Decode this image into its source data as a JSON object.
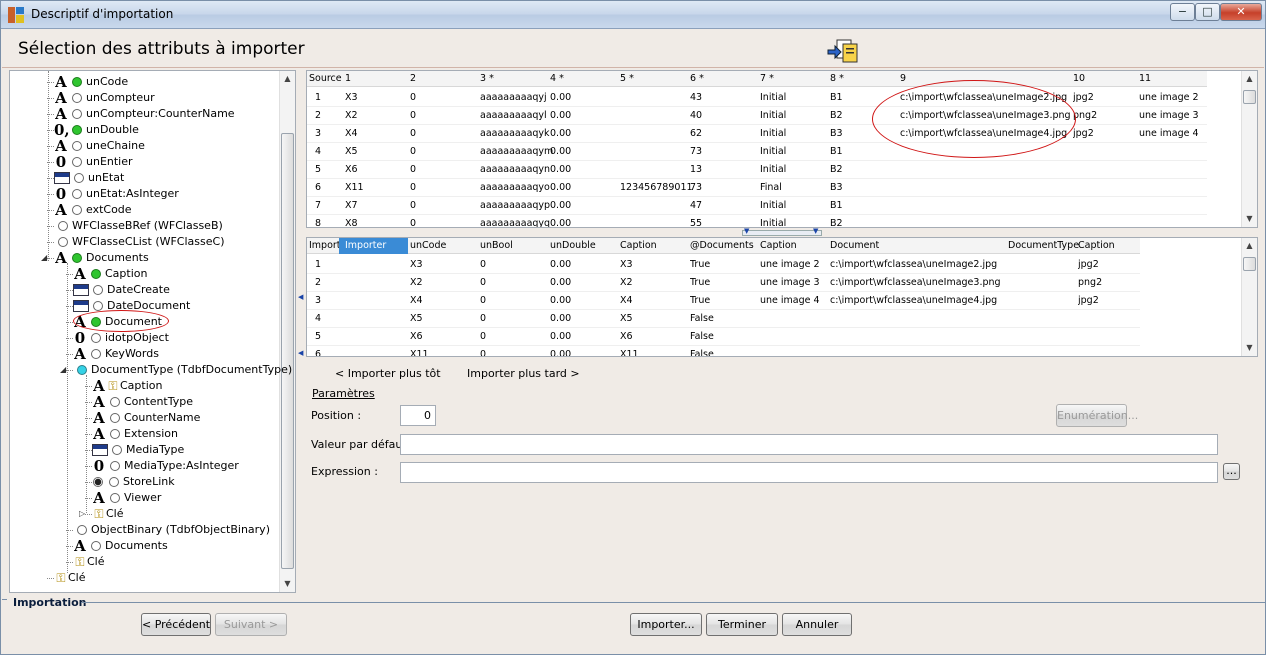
{
  "window": {
    "title": "Descriptif d'importation",
    "minimize": "−",
    "maximize": "□",
    "close": "✕"
  },
  "page_title": "Sélection des attributs à importer",
  "tree": {
    "items": [
      {
        "icon": "A",
        "dot": "green",
        "label": "unCode"
      },
      {
        "icon": "A",
        "dot": "empty",
        "label": "unCompteur"
      },
      {
        "icon": "A",
        "dot": "empty",
        "label": "unCompteur:CounterName"
      },
      {
        "icon": "0,",
        "dot": "green",
        "label": "unDouble"
      },
      {
        "icon": "A",
        "dot": "empty",
        "label": "uneChaine"
      },
      {
        "icon": "0",
        "dot": "empty",
        "label": "unEntier"
      },
      {
        "icon": "enum",
        "dot": "empty",
        "label": "unEtat"
      },
      {
        "icon": "0",
        "dot": "empty",
        "label": "unEtat:AsInteger"
      },
      {
        "icon": "A",
        "dot": "empty",
        "label": "extCode"
      },
      {
        "icon": "",
        "dot": "empty",
        "label": "WFClasseBRef (WFClasseB)"
      },
      {
        "icon": "",
        "dot": "empty",
        "label": "WFClasseCList (WFClasseC)"
      },
      {
        "icon": "A",
        "dot": "green",
        "label": "Documents"
      },
      {
        "icon": "A",
        "dot": "green",
        "label": "Caption"
      },
      {
        "icon": "date",
        "dot": "empty",
        "label": "DateCreate"
      },
      {
        "icon": "date",
        "dot": "empty",
        "label": "DateDocument"
      },
      {
        "icon": "A",
        "dot": "green",
        "label": "Document"
      },
      {
        "icon": "0",
        "dot": "empty",
        "label": "idotpObject"
      },
      {
        "icon": "A",
        "dot": "empty",
        "label": "KeyWords"
      },
      {
        "icon": "",
        "dot": "cyan",
        "label": "DocumentType (TdbfDocumentType)"
      },
      {
        "icon": "A",
        "dot": "key",
        "label": "Caption"
      },
      {
        "icon": "A",
        "dot": "empty",
        "label": "ContentType"
      },
      {
        "icon": "A",
        "dot": "empty",
        "label": "CounterName"
      },
      {
        "icon": "A",
        "dot": "empty",
        "label": "Extension"
      },
      {
        "icon": "enum",
        "dot": "empty",
        "label": "MediaType"
      },
      {
        "icon": "0",
        "dot": "empty",
        "label": "MediaType:AsInteger"
      },
      {
        "icon": "radio",
        "dot": "empty",
        "label": "StoreLink"
      },
      {
        "icon": "A",
        "dot": "empty",
        "label": "Viewer"
      },
      {
        "icon": "key",
        "dot": "none",
        "label": "Clé"
      },
      {
        "icon": "",
        "dot": "empty",
        "label": "ObjectBinary (TdbfObjectBinary)"
      },
      {
        "icon": "A",
        "dot": "empty",
        "label": "Documents"
      },
      {
        "icon": "key",
        "dot": "none",
        "label": "Clé"
      },
      {
        "icon": "key",
        "dot": "none",
        "label": "Clé"
      }
    ]
  },
  "source_grid": {
    "headers": [
      "Source",
      "1",
      "2",
      "3 *",
      "4 *",
      "5 *",
      "6 *",
      "7 *",
      "8 *",
      "9",
      "10",
      "11"
    ],
    "rows": [
      [
        "1",
        "X3",
        "0",
        "aaaaaaaaaqyj",
        "0.00",
        "",
        "43",
        "Initial",
        "B1",
        "c:\\import\\wfclassea\\uneImage2.jpg",
        "jpg2",
        "une image 2"
      ],
      [
        "2",
        "X2",
        "0",
        "aaaaaaaaaqyl",
        "0.00",
        "",
        "40",
        "Initial",
        "B2",
        "c:\\import\\wfclassea\\uneImage3.png",
        "png2",
        "une image 3"
      ],
      [
        "3",
        "X4",
        "0",
        "aaaaaaaaaqyk",
        "0.00",
        "",
        "62",
        "Initial",
        "B3",
        "c:\\import\\wfclassea\\uneImage4.jpg",
        "jpg2",
        "une image 4"
      ],
      [
        "4",
        "X5",
        "0",
        "aaaaaaaaaqym",
        "0.00",
        "",
        "73",
        "Initial",
        "B1",
        "",
        "",
        ""
      ],
      [
        "5",
        "X6",
        "0",
        "aaaaaaaaaqyn",
        "0.00",
        "",
        "13",
        "Initial",
        "B2",
        "",
        "",
        ""
      ],
      [
        "6",
        "X11",
        "0",
        "aaaaaaaaaqyo",
        "0.00",
        "123456789011",
        "73",
        "Final",
        "B3",
        "",
        "",
        ""
      ],
      [
        "7",
        "X7",
        "0",
        "aaaaaaaaaqyp",
        "0.00",
        "",
        "47",
        "Initial",
        "B1",
        "",
        "",
        ""
      ],
      [
        "8",
        "X8",
        "0",
        "aaaaaaaaaqyq",
        "0.00",
        "",
        "55",
        "Initial",
        "B2",
        "",
        "",
        ""
      ]
    ]
  },
  "import_grid": {
    "headers": [
      "Import",
      "Importer",
      "unCode",
      "unBool",
      "unDouble",
      "Caption",
      "@Documents",
      "Caption",
      "Document",
      "DocumentType",
      "Caption"
    ],
    "rows": [
      [
        "1",
        "",
        "X3",
        "0",
        "0.00",
        "X3",
        "True",
        "une image 2",
        "c:\\import\\wfclassea\\uneImage2.jpg",
        "",
        "jpg2"
      ],
      [
        "2",
        "",
        "X2",
        "0",
        "0.00",
        "X2",
        "True",
        "une image 3",
        "c:\\import\\wfclassea\\uneImage3.png",
        "",
        "png2"
      ],
      [
        "3",
        "",
        "X4",
        "0",
        "0.00",
        "X4",
        "True",
        "une image 4",
        "c:\\import\\wfclassea\\uneImage4.jpg",
        "",
        "jpg2"
      ],
      [
        "4",
        "",
        "X5",
        "0",
        "0.00",
        "X5",
        "False",
        "",
        "",
        "",
        ""
      ],
      [
        "5",
        "",
        "X6",
        "0",
        "0.00",
        "X6",
        "False",
        "",
        "",
        "",
        ""
      ],
      [
        "6",
        "",
        "X11",
        "0",
        "0.00",
        "X11",
        "False",
        "",
        "",
        "",
        ""
      ]
    ]
  },
  "nav": {
    "earlier": "< Importer plus tôt",
    "later": "Importer plus tard >"
  },
  "params": {
    "title": "Paramètres",
    "position_label": "Position :",
    "position_value": "0",
    "enum_button": "Enumération...",
    "default_label": "Valeur par défaut :",
    "default_value": "",
    "expression_label": "Expression :",
    "expression_value": "",
    "ellipsis_button": "..."
  },
  "footer": {
    "section": "Importation",
    "previous": "< Précédent",
    "next": "Suivant >",
    "import": "Importer...",
    "finish": "Terminer",
    "cancel": "Annuler"
  },
  "colors": {
    "selected_header": "#3a8bd6",
    "annotation": "#d01616",
    "active_dot": "#2fc52f"
  }
}
